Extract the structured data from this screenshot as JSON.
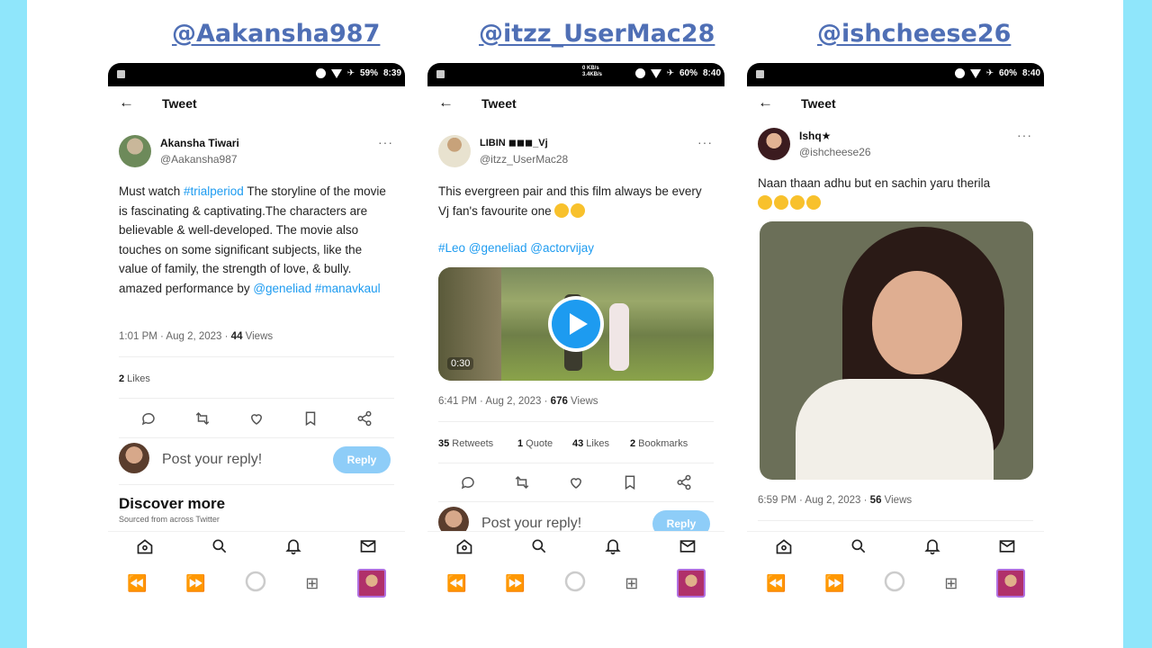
{
  "handles": [
    "@Aakansha987",
    "@itzz_UserMac28",
    "@ishcheese26"
  ],
  "phones": [
    {
      "status": {
        "battery": "59%",
        "time": "8:39"
      },
      "appbar_title": "Tweet",
      "user": {
        "name": "Akansha Tiwari",
        "handle": "@Aakansha987"
      },
      "text": {
        "p1": "Must watch ",
        "tag1": "#trialperiod",
        "p2": " The storyline of the movie is fascinating & captivating.The characters are believable & well-developed. The movie also touches on some significant subjects, like the value of family, the strength of love, & bully. amazed performance by ",
        "mention": "@geneliad",
        "tag2": "#manavkaul"
      },
      "meta": {
        "time": "1:01 PM · Aug 2, 2023 · ",
        "views_count": "44",
        "views_label": " Views"
      },
      "likes": {
        "count": "2",
        "label": " Likes"
      },
      "reply_placeholder": "Post your reply!",
      "reply_button": "Reply",
      "discover_title": "Discover more",
      "discover_sub": "Sourced from across Twitter"
    },
    {
      "status": {
        "battery": "60%",
        "time": "8:40",
        "net_top": "0 KB/s",
        "net_bottom": "3.4KB/s"
      },
      "appbar_title": "Tweet",
      "user": {
        "name": "LIBIN ◼◼◼_Vj",
        "handle": "@itzz_UserMac28"
      },
      "text": {
        "p1": "This evergreen pair and this film always be every Vj fan's favourite one ",
        "tags": "#Leo @geneliad @actorvijay"
      },
      "video_duration": "0:30",
      "meta": {
        "time": "6:41 PM · Aug 2, 2023 · ",
        "views_count": "676",
        "views_label": " Views"
      },
      "stats": [
        {
          "count": "35",
          "label": " Retweets"
        },
        {
          "count": "1",
          "label": " Quote"
        },
        {
          "count": "43",
          "label": " Likes"
        },
        {
          "count": "2",
          "label": " Bookmarks"
        }
      ],
      "reply_placeholder": "Post your reply!",
      "reply_button": "Reply"
    },
    {
      "status": {
        "battery": "60%",
        "time": "8:40"
      },
      "appbar_title": "Tweet",
      "user": {
        "name": "Ishq★",
        "handle": "@ishcheese26"
      },
      "text": {
        "p1": "Naan thaan adhu but en sachin yaru therila"
      },
      "meta": {
        "time": "6:59 PM · Aug 2, 2023 · ",
        "views_count": "56",
        "views_label": " Views"
      }
    }
  ],
  "colors": {
    "link": "#1d9bf0",
    "handle_title": "#4f6fb5",
    "background": "#8fe6fb",
    "reply_button": "#8ecdf8"
  },
  "icons": {
    "bottom_nav": [
      "home-icon",
      "search-icon",
      "bell-icon",
      "mail-icon"
    ],
    "actions": [
      "reply-icon",
      "retweet-icon",
      "like-icon",
      "bookmark-icon",
      "share-icon"
    ],
    "system_nav": [
      "rewind-icon",
      "fast-forward-icon",
      "loading-icon",
      "gift-icon",
      "thumbnail"
    ]
  }
}
